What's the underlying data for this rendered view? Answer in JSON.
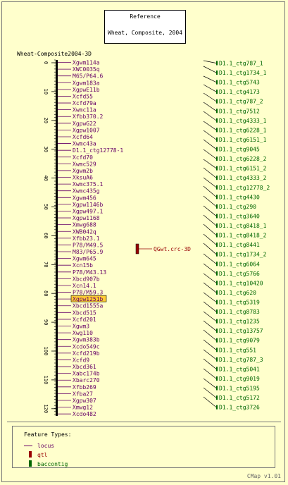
{
  "reference": {
    "title": "Reference",
    "subtitle": "Wheat, Composite, 2004"
  },
  "map": {
    "title": "Wheat-Composite2004-3D",
    "axis_ticks": [
      "0",
      "10",
      "20",
      "30",
      "40",
      "50",
      "60",
      "70",
      "80",
      "90",
      "100",
      "110",
      "120"
    ],
    "highlighted_marker": "Xgpw1251b",
    "markers": [
      "Xgwm114a",
      "XWC0035q",
      "M65/P64.6",
      "Xgwm183a",
      "XgpwE11b",
      "Xcfd55",
      "Xcfd79a",
      "Xwmc11a",
      "Xfbb370.2",
      "XgpwG22",
      "Xgpw1007",
      "Xcfd64",
      "Xwmc43a",
      "D1.1_ctg12778-1",
      "Xcfd70",
      "Xwmc529",
      "Xgwm2b",
      "XksuA6",
      "Xwmc375.1",
      "Xwmc435g",
      "Xgwm456",
      "Xgpw1146b",
      "Xgpw497.1",
      "Xgpw1168",
      "Xmwg688",
      "XWB042q",
      "Xfbb23.1",
      "P78/M49.5",
      "M83/P65.9",
      "Xgwm645",
      "Xcn15b",
      "P78/M43.13",
      "Xbcd907b",
      "Xcn14.1",
      "P78/M59.3",
      "Xgpw1251b",
      "Xbcd1555a",
      "Xbcd515",
      "Xcfd201",
      "Xgwm3",
      "Xwg110",
      "Xgwm383b",
      "Xcdo549c",
      "Xcfd219b",
      "Xcfd9",
      "Xbcd361",
      "Xabc174b",
      "Xbarc270",
      "Xfbb269",
      "Xfba27",
      "Xgpw307",
      "Xmwg12",
      "Xcdo482"
    ],
    "qtl": {
      "label": "QGwt.crc-3D"
    },
    "contigs": [
      "D1.1_ctg787_1",
      "D1.1_ctg1734_1",
      "D1.1_ctg5743",
      "D1.1_ctg4173",
      "D1.1_ctg787_2",
      "D1.1_ctg7512",
      "D1.1_ctg4333_1",
      "D1.1_ctg6228_1",
      "D1.1_ctg6151_1",
      "D1.1_ctg9045",
      "D1.1_ctg6228_2",
      "D1.1_ctg6151_2",
      "D1.1_ctg4333_2",
      "D1.1_ctg12778_2",
      "D1.1_ctg4430",
      "D1.1_ctg290",
      "D1.1_ctg3640",
      "D1.1_ctg8418_1",
      "D1.1_ctg8418_2",
      "D1.1_ctg8441",
      "D1.1_ctg1734_2",
      "D1.1_ctg6064",
      "D1.1_ctg5766",
      "D1.1_ctg10420",
      "D1.1_ctg620",
      "D1.1_ctg5319",
      "D1.1_ctg8783",
      "D1.1_ctg1235",
      "D1.1_ctg13757",
      "D1.1_ctg9079",
      "D1.1_ctg551",
      "D1.1_ctg787_3",
      "D1.1_ctg5041",
      "D1.1_ctg9019",
      "D1.1_ctg5195",
      "D1.1_ctg5172",
      "D1.1_ctg3726"
    ]
  },
  "legend": {
    "title": "Feature Types:",
    "items": [
      {
        "label": "locus",
        "kind": "line",
        "color": "#660066"
      },
      {
        "label": "qtl",
        "kind": "box",
        "color": "#990000"
      },
      {
        "label": "baccontig",
        "kind": "box",
        "color": "#006600"
      }
    ]
  },
  "footer": {
    "version": "CMap v1.01"
  },
  "colors": {
    "background": "#ffffcc",
    "locus": "#660066",
    "qtl": "#990000",
    "contig": "#006600",
    "highlight": "#ffcc33"
  }
}
